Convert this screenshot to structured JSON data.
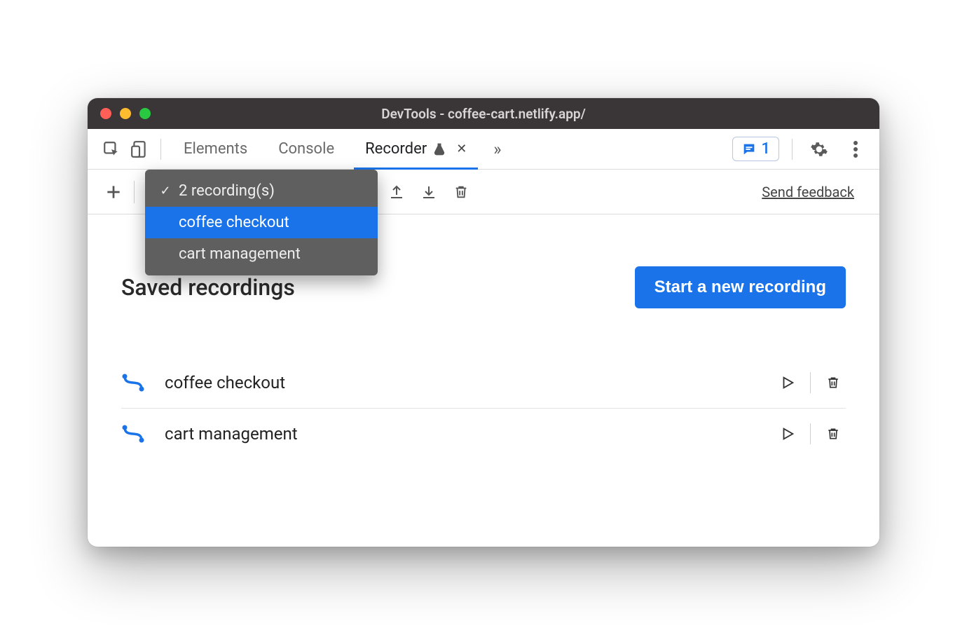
{
  "window": {
    "title": "DevTools - coffee-cart.netlify.app/"
  },
  "tabs": {
    "elements": "Elements",
    "console": "Console",
    "recorder": "Recorder"
  },
  "feedback_chip_count": "1",
  "toolbar": {
    "send_feedback": "Send feedback"
  },
  "dropdown": {
    "summary": "2 recording(s)",
    "option1": "coffee checkout",
    "option2": "cart management"
  },
  "page": {
    "heading": "Saved recordings",
    "start_button": "Start a new recording"
  },
  "recordings": {
    "items": [
      {
        "name": "coffee checkout"
      },
      {
        "name": "cart management"
      }
    ]
  }
}
